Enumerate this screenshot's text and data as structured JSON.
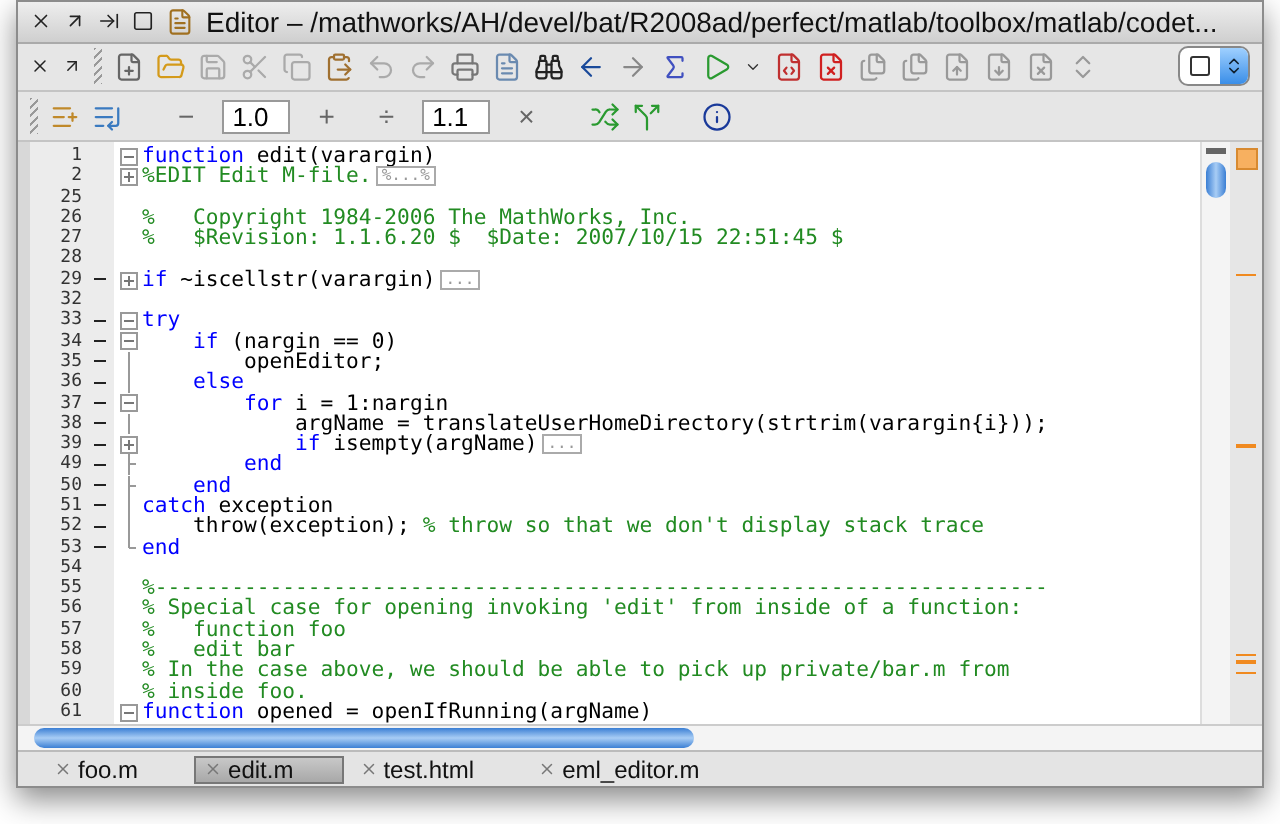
{
  "window": {
    "title": "Editor – /mathworks/AH/devel/bat/R2008ad/perfect/matlab/toolbox/matlab/codet..."
  },
  "cell_toolbar": {
    "items": [
      {
        "kind": "sign",
        "text": "−"
      },
      {
        "kind": "field",
        "value": "1.0"
      },
      {
        "kind": "sign",
        "text": "+"
      },
      {
        "kind": "sign",
        "text": "÷"
      },
      {
        "kind": "field",
        "value": "1.1"
      },
      {
        "kind": "sign",
        "text": "×"
      }
    ]
  },
  "editor": {
    "lines": [
      {
        "number": "1",
        "executable": false,
        "kind": "expanded",
        "segments": [
          {
            "kind": "keyword",
            "text": "function"
          },
          {
            "kind": "plain",
            "text": " edit(varargin)"
          }
        ]
      },
      {
        "number": "2",
        "executable": false,
        "kind": "collapsed",
        "segments": [
          {
            "kind": "comment",
            "text": "%EDIT Edit M-file."
          },
          {
            "kind": "folded",
            "text": "%...%"
          }
        ]
      },
      {
        "number": "25",
        "executable": false,
        "kind": "plain"
      },
      {
        "number": "26",
        "executable": false,
        "kind": "plain",
        "segments": [
          {
            "kind": "comment",
            "text": "%   Copyright 1984-2006 The MathWorks, Inc."
          }
        ]
      },
      {
        "number": "27",
        "executable": false,
        "kind": "plain",
        "segments": [
          {
            "kind": "comment",
            "text": "%   $Revision: 1.1.6.20 $  $Date: 2007/10/15 22:51:45 $"
          }
        ]
      },
      {
        "number": "28",
        "executable": false,
        "kind": "plain"
      },
      {
        "number": "29",
        "executable": true,
        "kind": "collapsed",
        "segments": [
          {
            "kind": "keyword",
            "text": "if"
          },
          {
            "kind": "plain",
            "text": " ~iscellstr(varargin)"
          },
          {
            "kind": "folded",
            "text": "..."
          }
        ]
      },
      {
        "number": "32",
        "executable": false,
        "kind": "plain"
      },
      {
        "number": "33",
        "executable": true,
        "kind": "expanded",
        "segments": [
          {
            "kind": "keyword",
            "text": "try"
          }
        ]
      },
      {
        "number": "34",
        "executable": true,
        "kind": "expanded",
        "segments": [
          {
            "kind": "keyword",
            "text": "    if"
          },
          {
            "kind": "plain",
            "text": " (nargin == 0)"
          }
        ]
      },
      {
        "number": "35",
        "executable": true,
        "kind": "line",
        "segments": [
          {
            "kind": "plain",
            "text": "        openEditor;"
          }
        ]
      },
      {
        "number": "36",
        "executable": true,
        "kind": "line",
        "segments": [
          {
            "kind": "keyword",
            "text": "    else"
          }
        ]
      },
      {
        "number": "37",
        "executable": true,
        "kind": "expanded",
        "segments": [
          {
            "kind": "keyword",
            "text": "        for"
          },
          {
            "kind": "plain",
            "text": " i = 1:nargin"
          }
        ]
      },
      {
        "number": "38",
        "executable": true,
        "kind": "line",
        "segments": [
          {
            "kind": "plain",
            "text": "            argName = translateUserHomeDirectory(strtrim(varargin{i}));"
          }
        ]
      },
      {
        "number": "39",
        "executable": true,
        "kind": "collapsed",
        "segments": [
          {
            "kind": "keyword",
            "text": "            if"
          },
          {
            "kind": "plain",
            "text": " isempty(argName)"
          },
          {
            "kind": "folded",
            "text": "..."
          }
        ]
      },
      {
        "number": "49",
        "executable": true,
        "kind": "tick",
        "segments": [
          {
            "kind": "keyword",
            "text": "        end"
          }
        ]
      },
      {
        "number": "50",
        "executable": true,
        "kind": "tick",
        "segments": [
          {
            "kind": "keyword",
            "text": "    end"
          }
        ]
      },
      {
        "number": "51",
        "executable": true,
        "kind": "line",
        "segments": [
          {
            "kind": "keyword",
            "text": "catch"
          },
          {
            "kind": "plain",
            "text": " exception"
          }
        ]
      },
      {
        "number": "52",
        "executable": true,
        "kind": "line",
        "segments": [
          {
            "kind": "plain",
            "text": "    throw(exception); "
          },
          {
            "kind": "comment",
            "text": "% throw so that we don't display stack trace"
          }
        ]
      },
      {
        "number": "53",
        "executable": true,
        "kind": "end",
        "segments": [
          {
            "kind": "keyword",
            "text": "end"
          }
        ]
      },
      {
        "number": "54",
        "executable": false,
        "kind": "plain"
      },
      {
        "number": "55",
        "executable": false,
        "kind": "plain",
        "segments": [
          {
            "kind": "comment",
            "text": "%----------------------------------------------------------------------"
          }
        ]
      },
      {
        "number": "56",
        "executable": false,
        "kind": "plain",
        "segments": [
          {
            "kind": "comment",
            "text": "% Special case for opening invoking 'edit' from inside of a function:"
          }
        ]
      },
      {
        "number": "57",
        "executable": false,
        "kind": "plain",
        "segments": [
          {
            "kind": "comment",
            "text": "%   function foo"
          }
        ]
      },
      {
        "number": "58",
        "executable": false,
        "kind": "plain",
        "segments": [
          {
            "kind": "comment",
            "text": "%   edit bar"
          }
        ]
      },
      {
        "number": "59",
        "executable": false,
        "kind": "plain",
        "segments": [
          {
            "kind": "comment",
            "text": "% In the case above, we should be able to pick up private/bar.m from"
          }
        ]
      },
      {
        "number": "60",
        "executable": false,
        "kind": "plain",
        "segments": [
          {
            "kind": "comment",
            "text": "% inside foo."
          }
        ]
      },
      {
        "number": "61",
        "executable": false,
        "kind": "expanded",
        "segments": [
          {
            "kind": "keyword",
            "text": "function"
          },
          {
            "kind": "plain",
            "text": " opened = openIfRunning(argName)"
          }
        ]
      }
    ]
  },
  "tabs": [
    {
      "label": "foo.m",
      "selected": false
    },
    {
      "label": "edit.m",
      "selected": true
    },
    {
      "label": "test.html",
      "selected": false
    },
    {
      "label": "eml_editor.m",
      "selected": false
    }
  ]
}
